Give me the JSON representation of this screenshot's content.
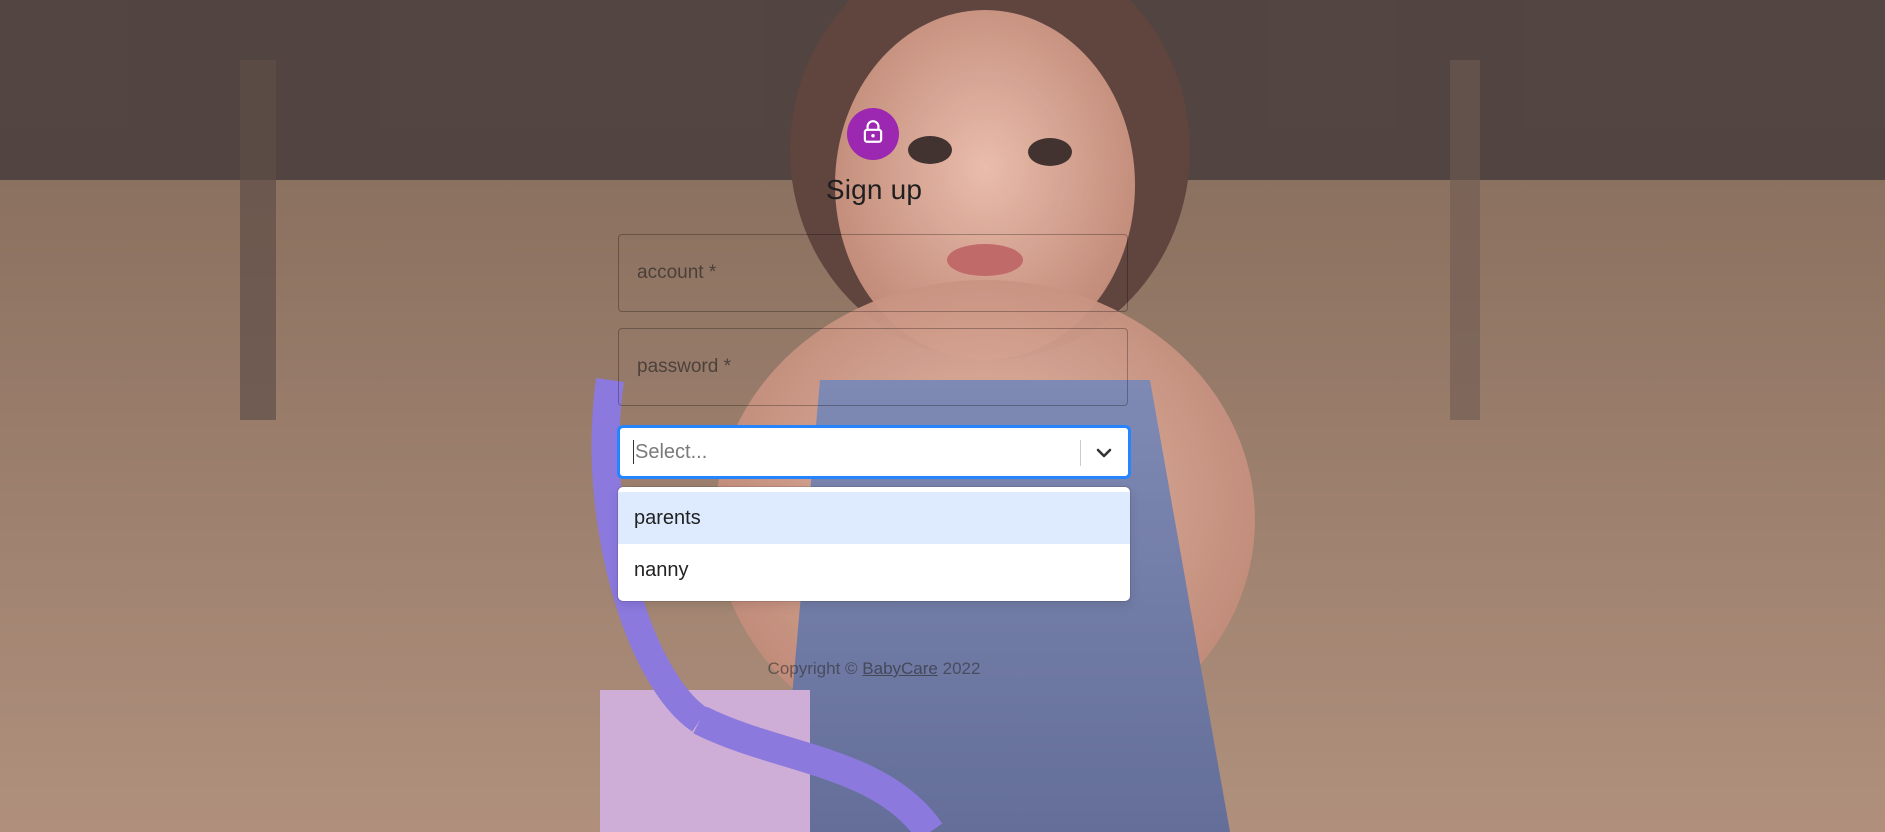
{
  "form": {
    "title": "Sign up",
    "account_label": "account *",
    "password_label": "password *"
  },
  "role_select": {
    "placeholder": "Select...",
    "options": [
      "parents",
      "nanny"
    ],
    "highlighted_option": "parents"
  },
  "footer": {
    "prefix": "Copyright © ",
    "brand_link": "BabyCare",
    "year": " 2022"
  },
  "colors": {
    "avatar": "#9c27b0",
    "focus_border": "#2684ff",
    "option_highlight": "#deebff"
  },
  "icons": {
    "avatar": "lock-icon",
    "select_indicator": "chevron-down-icon"
  }
}
